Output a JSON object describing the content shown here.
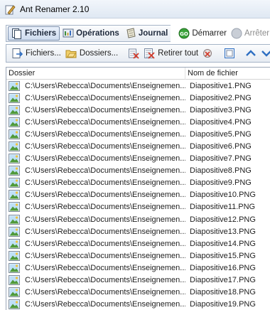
{
  "app": {
    "title": "Ant Renamer 2.10"
  },
  "tabs": [
    {
      "label": "Fichiers",
      "icon": "files-icon",
      "active": true
    },
    {
      "label": "Opérations",
      "icon": "operations-icon",
      "active": false
    },
    {
      "label": "Journal",
      "icon": "journal-icon",
      "active": false
    }
  ],
  "actions": {
    "start_label": "Démarrer",
    "stop_label": "Arrêter"
  },
  "toolbar": {
    "files_label": "Fichiers...",
    "folders_label": "Dossiers...",
    "remove_all_label": "Retirer tout"
  },
  "list": {
    "columns": [
      "Dossier",
      "Nom de fichier"
    ],
    "rows": [
      {
        "folder": "C:\\Users\\Rebecca\\Documents\\Enseignemen...",
        "file": "Diapositive1.PNG"
      },
      {
        "folder": "C:\\Users\\Rebecca\\Documents\\Enseignemen...",
        "file": "Diapositive2.PNG"
      },
      {
        "folder": "C:\\Users\\Rebecca\\Documents\\Enseignemen...",
        "file": "Diapositive3.PNG"
      },
      {
        "folder": "C:\\Users\\Rebecca\\Documents\\Enseignemen...",
        "file": "Diapositive4.PNG"
      },
      {
        "folder": "C:\\Users\\Rebecca\\Documents\\Enseignemen...",
        "file": "Diapositive5.PNG"
      },
      {
        "folder": "C:\\Users\\Rebecca\\Documents\\Enseignemen...",
        "file": "Diapositive6.PNG"
      },
      {
        "folder": "C:\\Users\\Rebecca\\Documents\\Enseignemen...",
        "file": "Diapositive7.PNG"
      },
      {
        "folder": "C:\\Users\\Rebecca\\Documents\\Enseignemen...",
        "file": "Diapositive8.PNG"
      },
      {
        "folder": "C:\\Users\\Rebecca\\Documents\\Enseignemen...",
        "file": "Diapositive9.PNG"
      },
      {
        "folder": "C:\\Users\\Rebecca\\Documents\\Enseignemen...",
        "file": "Diapositive10.PNG"
      },
      {
        "folder": "C:\\Users\\Rebecca\\Documents\\Enseignemen...",
        "file": "Diapositive11.PNG"
      },
      {
        "folder": "C:\\Users\\Rebecca\\Documents\\Enseignemen...",
        "file": "Diapositive12.PNG"
      },
      {
        "folder": "C:\\Users\\Rebecca\\Documents\\Enseignemen...",
        "file": "Diapositive13.PNG"
      },
      {
        "folder": "C:\\Users\\Rebecca\\Documents\\Enseignemen...",
        "file": "Diapositive14.PNG"
      },
      {
        "folder": "C:\\Users\\Rebecca\\Documents\\Enseignemen...",
        "file": "Diapositive15.PNG"
      },
      {
        "folder": "C:\\Users\\Rebecca\\Documents\\Enseignemen...",
        "file": "Diapositive16.PNG"
      },
      {
        "folder": "C:\\Users\\Rebecca\\Documents\\Enseignemen...",
        "file": "Diapositive17.PNG"
      },
      {
        "folder": "C:\\Users\\Rebecca\\Documents\\Enseignemen...",
        "file": "Diapositive18.PNG"
      },
      {
        "folder": "C:\\Users\\Rebecca\\Documents\\Enseignemen...",
        "file": "Diapositive19.PNG"
      }
    ]
  },
  "colors": {
    "accent": "#2f6fc2",
    "start_green": "#3aa33a",
    "remove_red": "#d23a2a"
  }
}
